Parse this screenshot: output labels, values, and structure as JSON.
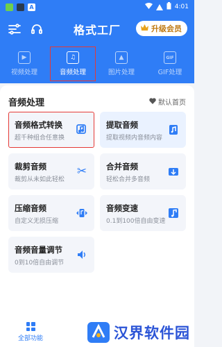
{
  "statusbar": {
    "time": "4:01",
    "icons": [
      "app-icon-green",
      "app-icon-dark",
      "app-icon-a"
    ]
  },
  "header": {
    "title": "格式工厂",
    "upgrade_label": "升级会员"
  },
  "tabs": [
    {
      "label": "视频处理",
      "icon": "video-icon",
      "active": false
    },
    {
      "label": "音频处理",
      "icon": "audio-icon",
      "active": true
    },
    {
      "label": "图片处理",
      "icon": "image-icon",
      "active": false
    },
    {
      "label": "GIF处理",
      "icon": "gif-icon",
      "active": false
    }
  ],
  "section": {
    "title": "音频处理",
    "default_home": "默认首页"
  },
  "cards": [
    {
      "title": "音频格式转换",
      "subtitle": "超千种组合任意换",
      "icon": "audio-convert-icon"
    },
    {
      "title": "提取音频",
      "subtitle": "提取视频内音频内容",
      "icon": "audio-extract-icon"
    },
    {
      "title": "裁剪音频",
      "subtitle": "裁剪从未如此轻松",
      "icon": "scissors-icon"
    },
    {
      "title": "合并音频",
      "subtitle": "轻松合并多音频",
      "icon": "merge-icon"
    },
    {
      "title": "压缩音频",
      "subtitle": "自定义无损压缩",
      "icon": "compress-icon"
    },
    {
      "title": "音频变速",
      "subtitle": "0.1到100倍自由变速",
      "icon": "speed-icon"
    },
    {
      "title": "音频音量调节",
      "subtitle": "0到10倍自由调节",
      "icon": "volume-icon"
    }
  ],
  "bottom": {
    "all_functions": "全部功能"
  },
  "watermark": {
    "text": "汉界软件园"
  },
  "colors": {
    "primary": "#2f7df6",
    "highlight": "#e53935",
    "gold": "#c07a12"
  }
}
